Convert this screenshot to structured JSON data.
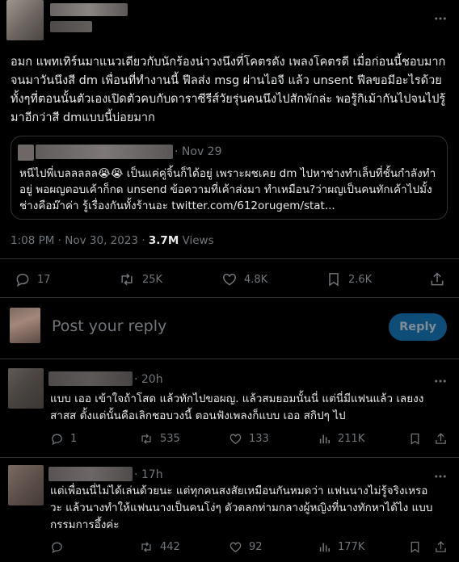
{
  "main_tweet": {
    "text": "อมก แพทเทิร์นมาแนวเดียวกับนักร้องน่าวงนึงที่โคตรดัง เพลงโคตรดี เมื่อก่อนนี้ชอบมาก จนมาวันนึงสี dm เพื่อนที่ทำงานนี้ ฟีลส่ง msg ผ่านไอจี แล้ว unsent ฟีลขอมีอะไรด้วย ทั้งๆที่ตอนนั้นตัวเองเปิดตัวคบกับดาราซีรีส์วัยรุ่นคนนึงไปสักพักล่ะ พอรู้กิเม้ากันไปจนไปรู้มาอีกว่าสี dmแบบนี้บ่อยมาก",
    "quote": {
      "date": "· Nov 29",
      "text": "หนีไปพี่เบลลลลล😭😭 เป็นแค่คู่จิ้นก็ได้อยู่ เพราะผชเคย dm ไปหาช่างทำเล็บที่ชั้นกำลังทำอยู่ พอผญตอบเค้าก็กด unsend ข้อความที่เค้าส่งมา ทำเหมือน?ว่าผญเป็นคนทักเค้าไปมั้ง ช่างคือม๊าค่า รู้เรื่องกันทั้งร้านอะ twitter.com/612orugem/stat..."
    },
    "timestamp": "1:08 PM · Nov 30, 2023 · ",
    "views_count": "3.7M",
    "views_label": " Views",
    "actions": {
      "replies": "17",
      "retweets": "25K",
      "likes": "4.8K",
      "bookmarks": "2.6K"
    }
  },
  "compose": {
    "placeholder": "Post your reply",
    "button": "Reply"
  },
  "replies": [
    {
      "time": "· 20h",
      "text": "แบบ เออ เข้าใจถ้าโสด แล้วทักไปขอผญ. แล้วสมยอมนั้นนี่ แต่นี่มีแฟนแล้ว เลยงงสาสส ตั้งแต่นั้นคือเลิกชอบวงนี้ ตอนฟังเพลงก็แบบ เออ สกิปๆ ไป",
      "actions": {
        "replies": "1",
        "retweets": "535",
        "likes": "133",
        "views": "211K"
      }
    },
    {
      "time": "· 17h",
      "text": "แต่เพื่อนนี่ไม่ได้เล่นด้วยนะ แต่ทุกคนสงสัยเหมือนกันหมดว่า แฟนนางไม่รู้จริงเหรอวะ แล้วนางทำให้แฟนนางเป็นคนโง่ๆ ตัวตลกท่ามกลางผู้หญิงที่นางทักหาได้ไง แบบกรรมการอึ้งค่ะ",
      "actions": {
        "replies": "",
        "retweets": "442",
        "likes": "92",
        "views": "177K"
      }
    }
  ],
  "colors": {
    "accent": "#1d9bf0",
    "muted": "#71767b",
    "border": "#2f3336",
    "background": "#000000"
  }
}
